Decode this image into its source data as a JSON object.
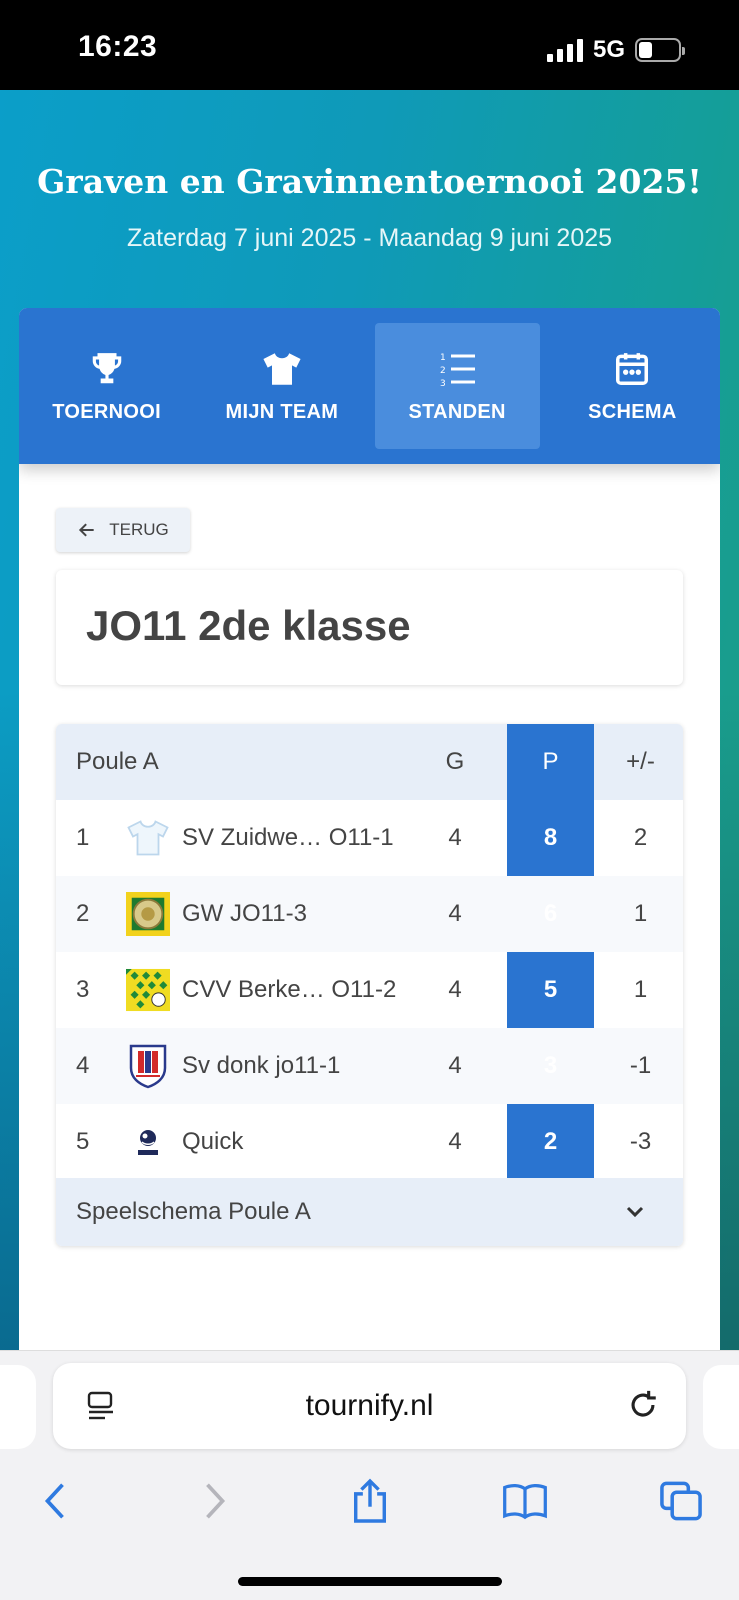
{
  "status": {
    "time": "16:23",
    "network": "5G"
  },
  "header": {
    "title": "Graven en Gravinnentoernooi 2025!",
    "dates": "Zaterdag 7 juni 2025 - Maandag 9 juni 2025"
  },
  "nav": {
    "items": [
      {
        "label": "TOERNOOI",
        "icon": "trophy-icon"
      },
      {
        "label": "MIJN TEAM",
        "icon": "shirt-icon"
      },
      {
        "label": "STANDEN",
        "icon": "ranking-list-icon",
        "active": true
      },
      {
        "label": "SCHEMA",
        "icon": "calendar-icon"
      }
    ]
  },
  "back_label": "TERUG",
  "page_title": "JO11 2de klasse",
  "standings": {
    "group": "Poule A",
    "columns": {
      "games": "G",
      "points": "P",
      "diff": "+/-"
    },
    "rows": [
      {
        "pos": "1",
        "team": "SV Zuidwe… O11-1",
        "g": "4",
        "p": "8",
        "diff": "2"
      },
      {
        "pos": "2",
        "team": "GW JO11-3",
        "g": "4",
        "p": "6",
        "diff": "1"
      },
      {
        "pos": "3",
        "team": "CVV Berke… O11-2",
        "g": "4",
        "p": "5",
        "diff": "1"
      },
      {
        "pos": "4",
        "team": "Sv donk jo11-1",
        "g": "4",
        "p": "3",
        "diff": "-1"
      },
      {
        "pos": "5",
        "team": "Quick",
        "g": "4",
        "p": "2",
        "diff": "-3"
      }
    ],
    "schedule_label": "Speelschema Poule A"
  },
  "browser": {
    "url": "tournify.nl"
  },
  "colors": {
    "primary": "#2a74d0",
    "active_tab": "#4a8ddd",
    "header_bg": "#e7eef8"
  }
}
